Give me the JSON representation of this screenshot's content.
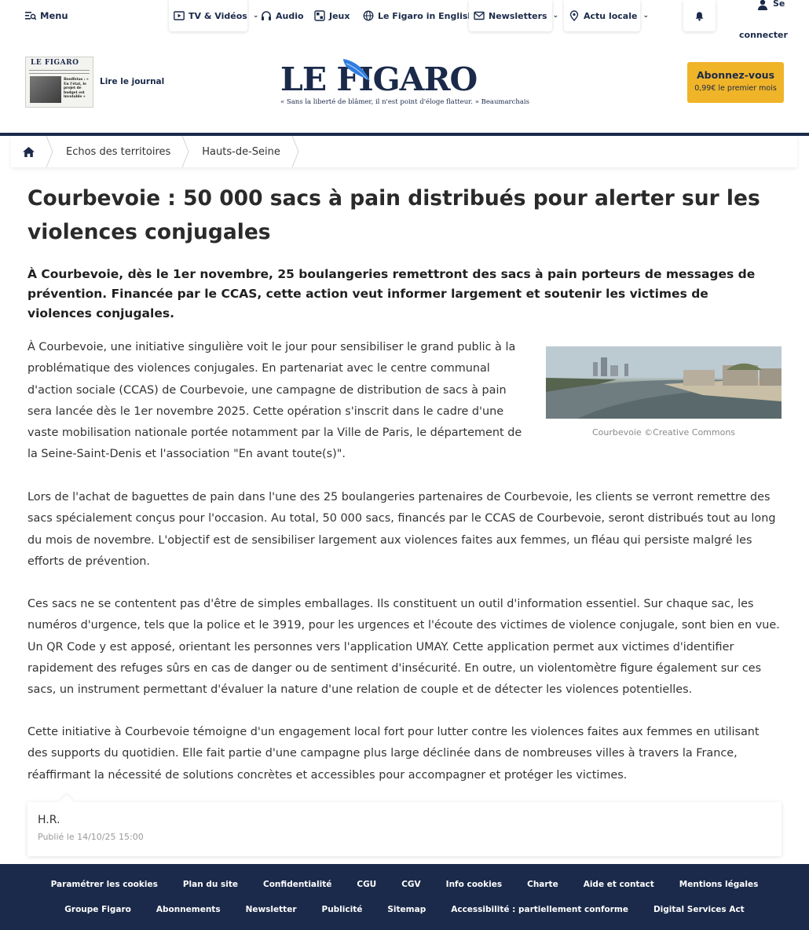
{
  "topnav": {
    "menu": "Menu",
    "items": [
      {
        "label": "TV & Vidéos",
        "icon": "play-icon",
        "dropdown": true
      },
      {
        "label": "Audio",
        "icon": "headphones-icon",
        "dropdown": false
      },
      {
        "label": "Jeux",
        "icon": "grid-icon",
        "dropdown": false
      },
      {
        "label": "Le Figaro in English",
        "icon": "globe-icon",
        "dropdown": false
      },
      {
        "label": "Newsletters",
        "icon": "mail-icon",
        "dropdown": true
      },
      {
        "label": "Actu locale",
        "icon": "location-pin-icon",
        "dropdown": true
      }
    ],
    "chevron": "⌄",
    "login_line1": "Se",
    "login_line2": "connecter"
  },
  "masthead": {
    "journal_label": "Lire le journal",
    "journal_thumb_title": "LE FIGARO",
    "journal_thumb_headline": "Bouffetas : « En l'état, le projet de budget est invotable »",
    "logo": "LE FIGARO",
    "tagline": "« Sans la liberté de blâmer, il n'est point d'éloge flatteur. » Beaumarchais",
    "subscribe_label": "Abonnez-vous",
    "subscribe_price": "0,99€ le premier mois",
    "brand_color": "#1b2a4a",
    "accent_color": "#f0b429"
  },
  "breadcrumb": [
    "Echos des territoires",
    "Hauts-de-Seine"
  ],
  "article": {
    "title": "Courbevoie : 50 000 sacs à pain distribués pour alerter sur les violences conjugales",
    "chapo": "À Courbevoie, dès le 1er novembre, 25 boulangeries remettront des sacs à pain porteurs de messages de prévention. Financée par le CCAS, cette action veut informer largement et soutenir les victimes de violences conjugales.",
    "paragraphs": [
      "À Courbevoie, une initiative singulière voit le jour pour sensibiliser le grand public à la problématique des violences conjugales. En partenariat avec le centre communal d'action sociale (CCAS) de Courbevoie, une campagne de distribution de sacs à pain sera lancée dès le 1er novembre 2025. Cette opération s'inscrit dans le cadre d'une vaste mobilisation nationale portée notamment par la Ville de Paris, le département de la Seine-Saint-Denis et l'association \"En avant toute(s)\".",
      "Lors de l'achat de baguettes de pain dans l'une des 25 boulangeries partenaires de Courbevoie, les clients se verront remettre des sacs spécialement conçus pour l'occasion. Au total, 50 000 sacs, financés par le CCAS de Courbevoie, seront distribués tout au long du mois de novembre. L'objectif est de sensibiliser largement aux violences faites aux femmes, un fléau qui persiste malgré les efforts de prévention.",
      "Ces sacs ne se contentent pas d'être de simples emballages. Ils constituent un outil d'information essentiel. Sur chaque sac, les numéros d'urgence, tels que la police et le 3919, pour les urgences et l'écoute des victimes de violence conjugale, sont bien en vue. Un QR Code y est apposé, orientant les personnes vers l'application UMAY. Cette application permet aux victimes d'identifier rapidement des refuges sûrs en cas de danger ou de sentiment d'insécurité. En outre, un violentomètre figure également sur ces sacs, un instrument permettant d'évaluer la nature d'une relation de couple et de détecter les violences potentielles.",
      "Cette initiative à Courbevoie témoigne d'un engagement local fort pour lutter contre les violences faites aux femmes en utilisant des supports du quotidien. Elle fait partie d'une campagne plus large déclinée dans de nombreuses villes à travers la France, réaffirmant la nécessité de solutions concrètes et accessibles pour accompagner et protéger les victimes."
    ],
    "image_caption": "Courbevoie ©Creative Commons",
    "author": "H.R.",
    "published": "Publié le 14/10/25 15:00"
  },
  "footer": {
    "row1": [
      "Paramétrer les cookies",
      "Plan du site",
      "Confidentialité",
      "CGU",
      "CGV",
      "Info cookies",
      "Charte",
      "Aide et contact",
      "Mentions légales"
    ],
    "row2": [
      "Groupe Figaro",
      "Abonnements",
      "Newsletter",
      "Publicité",
      "Sitemap",
      "Accessibilité : partiellement conforme",
      "Digital Services Act"
    ]
  }
}
